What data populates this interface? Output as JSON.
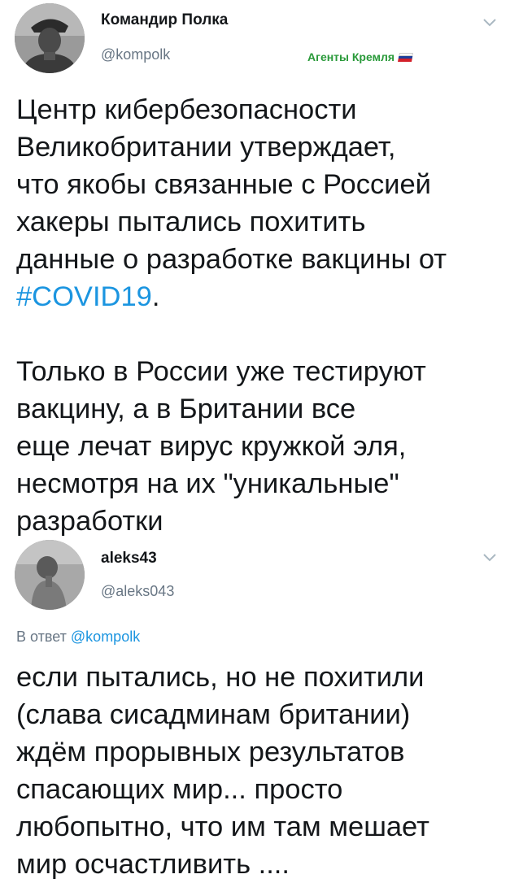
{
  "tweet_main": {
    "author_name": "Командир Полка",
    "author_handle": "@kompolk",
    "badge_text": "Агенты Кремля",
    "avatar_icon": "soldier-portrait-avatar",
    "text_lines": [
      "Центр кибербезопасности",
      "Великобритании утверждает,",
      "что якобы связанные с Россией",
      "хакеры пытались похитить",
      "данные о разработке вакцины от"
    ],
    "hashtag": "#COVID19",
    "hashtag_suffix": ".",
    "text_lines_2": [
      "Только в России уже тестируют",
      "вакцину, а в Британии все",
      "еще лечат вирус кружкой эля,",
      "несмотря на их \"уникальные\"",
      "разработки"
    ]
  },
  "tweet_reply": {
    "author_name": "aleks43",
    "author_handle": "@aleks043",
    "avatar_icon": "child-photo-avatar",
    "replying_prefix": "В ответ",
    "replying_mention": "@kompolk",
    "text_lines": [
      "если пытались, но не похитили",
      "(слава сисадминам британии)",
      "ждём прорывных результатов",
      "спасающих мир... просто",
      "любопытно, что им там мешает",
      "мир осчастливить ...."
    ]
  },
  "colors": {
    "link": "#1b95e0",
    "muted": "#687684",
    "badge": "#2a9a3a",
    "flag_white": "#ffffff",
    "flag_blue": "#1d3f9c",
    "flag_red": "#d3202a"
  }
}
